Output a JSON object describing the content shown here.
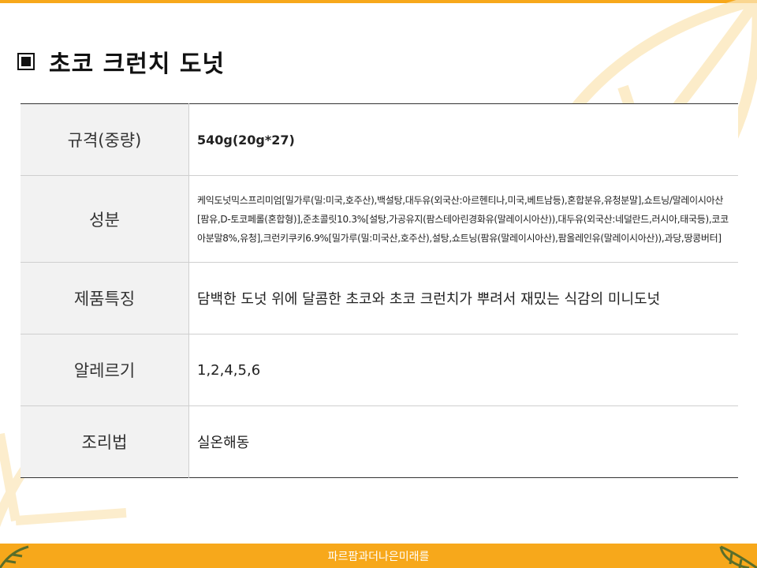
{
  "page": {
    "title": "초코 크런치 도넛",
    "title_icon": "square-bullet-icon"
  },
  "spec_table": {
    "rows": [
      {
        "label": "규격(중량)",
        "value": "540g(20g*27)"
      },
      {
        "label": "성분",
        "value": "케익도넛믹스프리미엄[밀가루(밀:미국,호주산),백설탕,대두유(외국산:아르헨티나,미국,베트남등),혼합분유,유청분말],쇼트닝/말레이시아산[팜유,D-토코페롤(혼합형)],준초콜릿10.3%[설탕,가공유지(팜스테아린경화유(말레이시아산)),대두유(외국산:네덜란드,러시아,태국등),코코아분말8%,유청],크런키쿠키6.9%[밀가루(밀:미국산,호주산),설탕,쇼트닝(팜유(말레이시아산),팜올레인유(말레이시아산)),과당,땅콩버터]"
      },
      {
        "label": "제품특징",
        "value": "담백한 도넛 위에 달콤한 초코와 초코 크런치가 뿌려서 재밌는 식감의 미니도넛"
      },
      {
        "label": "알레르기",
        "value": "1,2,4,5,6"
      },
      {
        "label": "조리법",
        "value": "실온해동"
      }
    ]
  },
  "footer": {
    "slogan": "파르팜과더나은미래를"
  },
  "colors": {
    "accent": "#f7a81b",
    "header_cell_bg": "#f2f2f2"
  }
}
